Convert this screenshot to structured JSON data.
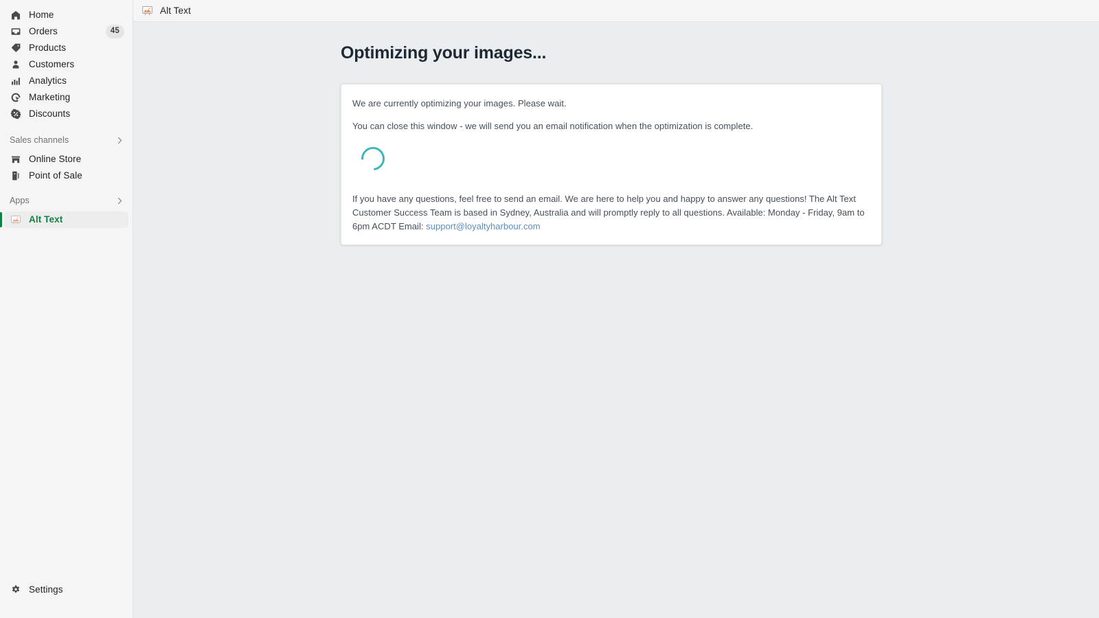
{
  "sidebar": {
    "primary_items": [
      {
        "label": "Home",
        "icon": "home-icon",
        "badge": null
      },
      {
        "label": "Orders",
        "icon": "orders-icon",
        "badge": "45"
      },
      {
        "label": "Products",
        "icon": "products-icon",
        "badge": null
      },
      {
        "label": "Customers",
        "icon": "customers-icon",
        "badge": null
      },
      {
        "label": "Analytics",
        "icon": "analytics-icon",
        "badge": null
      },
      {
        "label": "Marketing",
        "icon": "marketing-icon",
        "badge": null
      },
      {
        "label": "Discounts",
        "icon": "discounts-icon",
        "badge": null
      }
    ],
    "sales_channels": {
      "title": "Sales channels",
      "chevron_icon": "chevron-right-icon",
      "items": [
        {
          "label": "Online Store",
          "icon": "store-icon"
        },
        {
          "label": "Point of Sale",
          "icon": "pos-icon"
        }
      ]
    },
    "apps": {
      "title": "Apps",
      "chevron_icon": "chevron-right-icon",
      "items": [
        {
          "label": "Alt Text",
          "icon": "alt-text-app-icon",
          "active": true
        }
      ]
    },
    "settings": {
      "label": "Settings",
      "icon": "gear-icon"
    },
    "active_color": "#108043",
    "badge_bg": "#e4e5e7"
  },
  "topbar": {
    "title": "Alt Text",
    "icon": "alt-text-app-icon"
  },
  "main": {
    "page_title": "Optimizing your images...",
    "card": {
      "line1": "We are currently optimizing your images. Please wait.",
      "line2": "You can close this window - we will send you an email notification when the optimization is complete.",
      "spinner": {
        "name": "loading-spinner",
        "color": "#3cb6b9"
      },
      "support_text": "If you have any questions, feel free to send an email. We are here to help you and happy to answer any questions! The Alt Text Customer Success Team is based in Sydney, Australia and will promptly reply to all questions. Available: Monday - Friday, 9am to 6pm ACDT Email: ",
      "support_email": "support@loyaltyharbour.com",
      "link_color": "#5c8bbd"
    }
  }
}
